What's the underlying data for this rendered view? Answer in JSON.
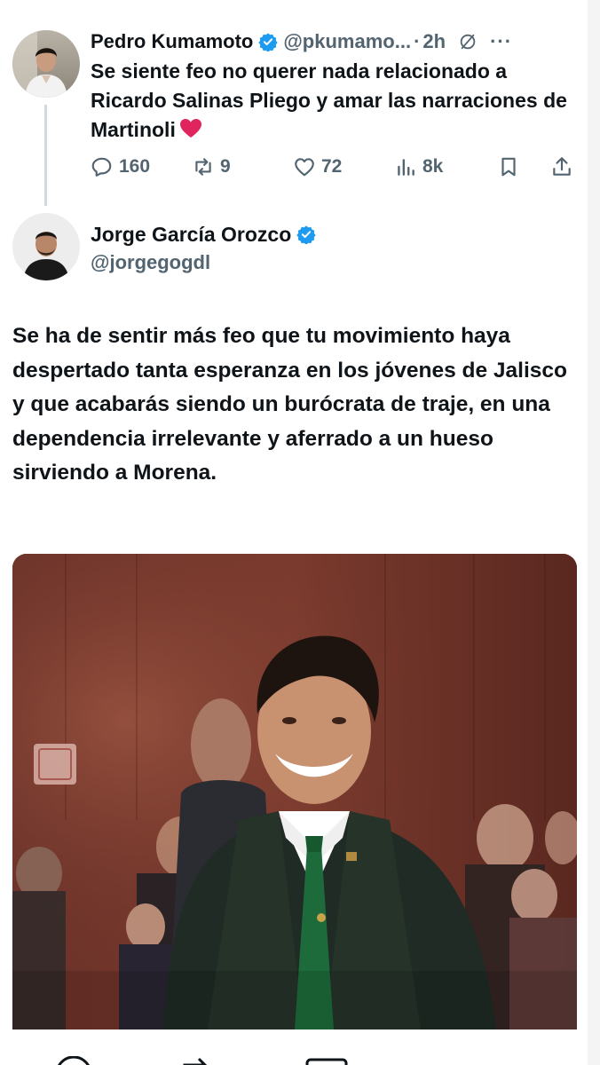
{
  "original_tweet": {
    "author_name": "Pedro Kumamoto",
    "handle": "@pkumamo...",
    "separator": "·",
    "time": "2h",
    "text": "Se siente feo no querer nada relacionado a Ricardo Salinas Pliego y amar las narraciones de Martinoli",
    "emoji_icon": "red-heart-icon",
    "stats": {
      "replies": "160",
      "retweets": "9",
      "likes": "72",
      "views": "8k"
    }
  },
  "reply_tweet": {
    "author_name": "Jorge García Orozco",
    "handle": "@jorgegogdl",
    "text": "Se ha de sentir más feo que tu movimiento haya despertado tanta esperanza en los jóvenes de Jalisco y que acabarás siendo un burócrata de traje, en una dependencia irrelevante y aferrado a un hueso sirviendo a Morena."
  },
  "colors": {
    "verified_blue": "#1d9bf0",
    "muted_text": "#536471",
    "thread_line": "#cfd9de",
    "heart_red": "#e0245e"
  },
  "icons": {
    "verified": "verified-badge-icon",
    "grok": "grok-icon",
    "more": "more-icon",
    "reply": "reply-icon",
    "retweet": "retweet-icon",
    "like": "heart-icon",
    "views": "views-icon",
    "bookmark": "bookmark-icon",
    "share": "share-icon"
  }
}
